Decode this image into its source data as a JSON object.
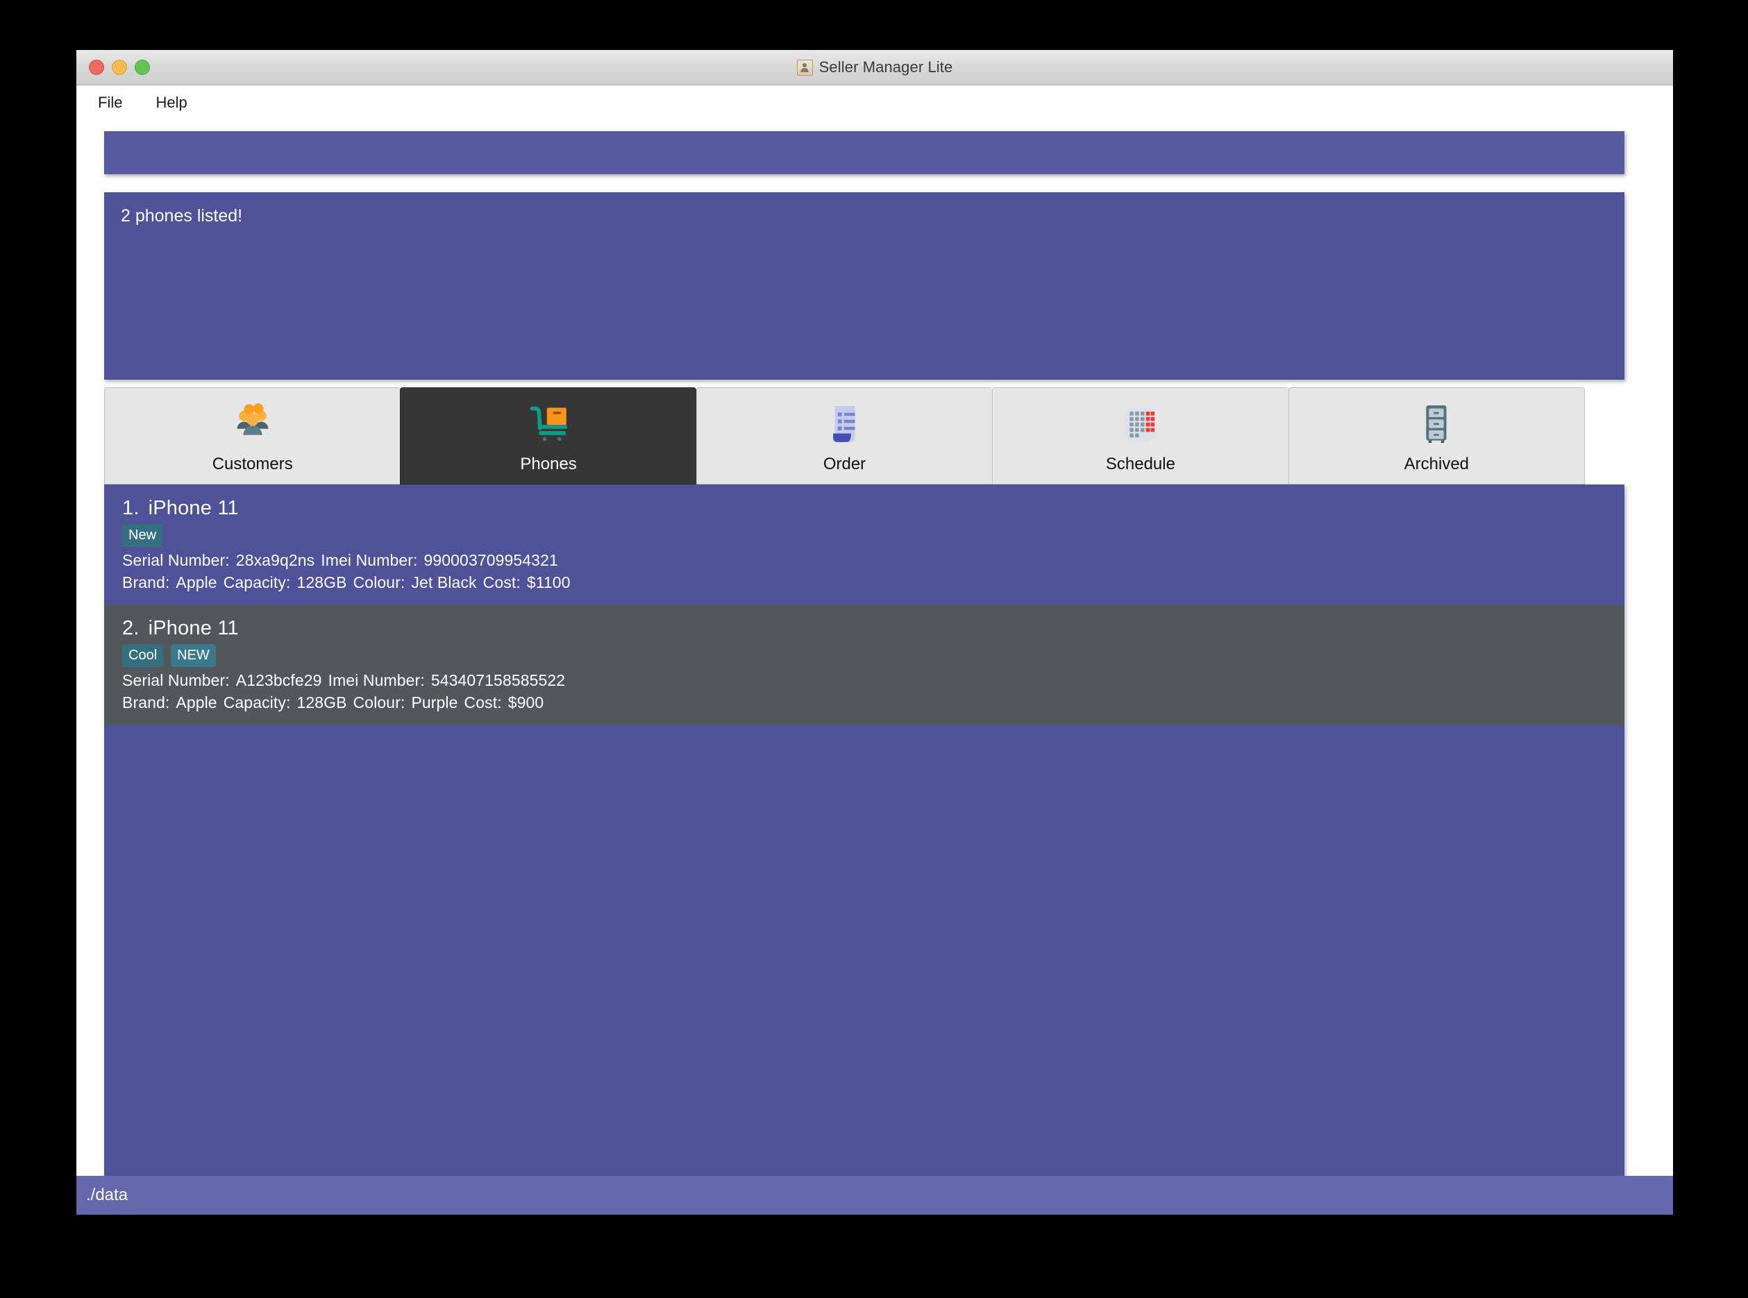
{
  "window": {
    "title": "Seller Manager Lite",
    "icon": "contact-card-icon",
    "traffic_lights": {
      "close": "close-window-button",
      "minimize": "minimize-window-button",
      "maximize": "maximize-window-button"
    }
  },
  "menubar": {
    "items": [
      {
        "label": "File",
        "name": "menu-file"
      },
      {
        "label": "Help",
        "name": "menu-help"
      }
    ]
  },
  "toolbar": {
    "band_color": "#565A9E"
  },
  "status_panel": {
    "message": "2 phones listed!",
    "background": "#4E5298"
  },
  "tabs": [
    {
      "label": "Customers",
      "icon": "people-group-icon",
      "selected": false
    },
    {
      "label": "Phones",
      "icon": "shopping-cart-icon",
      "selected": true
    },
    {
      "label": "Order",
      "icon": "document-list-icon",
      "selected": false
    },
    {
      "label": "Schedule",
      "icon": "calendar-grid-icon",
      "selected": false
    },
    {
      "label": "Archived",
      "icon": "file-cabinet-icon",
      "selected": false
    }
  ],
  "phones": [
    {
      "index": "1.",
      "model": "iPhone 11",
      "tags": [
        "New"
      ],
      "serial_label": "Serial Number:",
      "serial_value": "28xa9q2ns",
      "imei_label": "Imei Number:",
      "imei_value": "990003709954321",
      "brand_label": "Brand:",
      "brand_value": "Apple",
      "capacity_label": "Capacity:",
      "capacity_value": "128GB",
      "colour_label": "Colour:",
      "colour_value": "Jet Black",
      "cost_label": "Cost:",
      "cost_value": "$1100",
      "row_background": "#4E5298"
    },
    {
      "index": "2.",
      "model": "iPhone 11",
      "tags": [
        "Cool",
        "NEW"
      ],
      "serial_label": "Serial Number:",
      "serial_value": "A123bcfe29",
      "imei_label": "Imei Number:",
      "imei_value": "543407158585522",
      "brand_label": "Brand:",
      "brand_value": "Apple",
      "capacity_label": "Capacity:",
      "capacity_value": "128GB",
      "colour_label": "Colour:",
      "colour_value": "Purple",
      "cost_label": "Cost:",
      "cost_value": "$900",
      "row_background": "#52575C"
    }
  ],
  "statusbar": {
    "path": "./data",
    "background": "#6569AC"
  },
  "colors": {
    "accent_purple": "#4E5298",
    "toolbar_purple": "#565A9E",
    "statusbar_purple": "#6569AC",
    "selected_tab": "#363636",
    "selected_row": "#52575C",
    "tag_teal": "#3A7A8C"
  }
}
